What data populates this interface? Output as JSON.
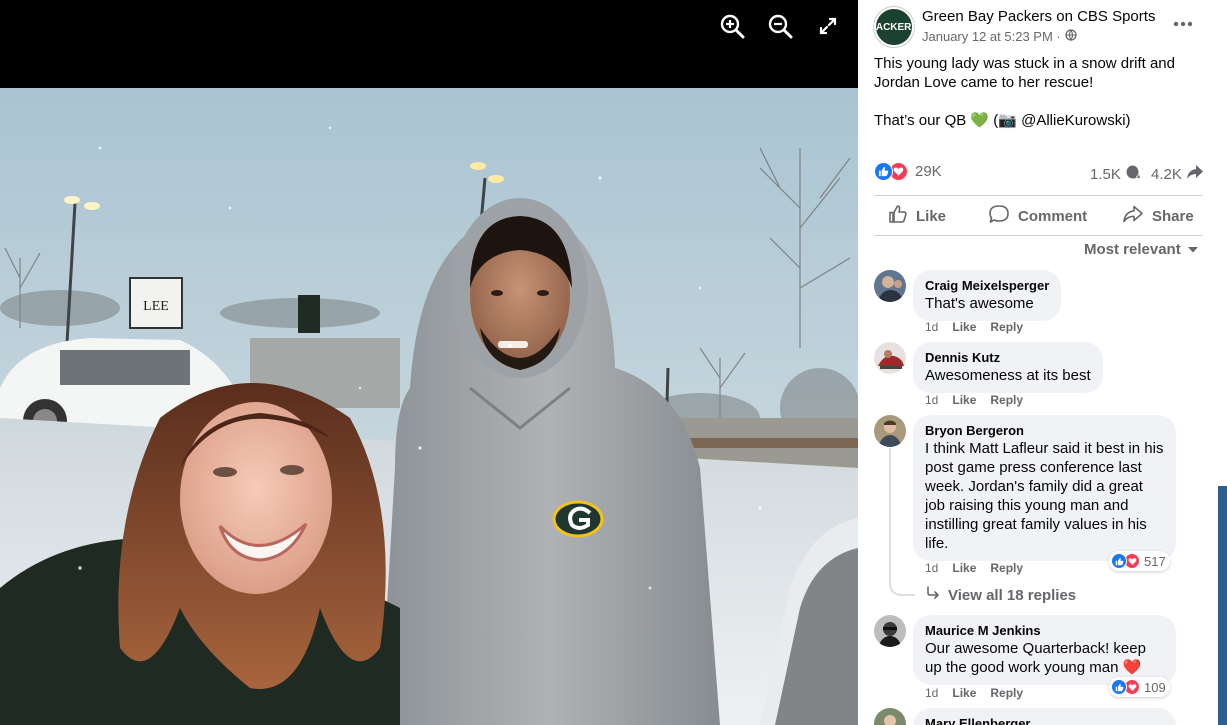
{
  "post": {
    "page_name": "Green Bay Packers on CBS Sports",
    "avatar_text": "PACKERS",
    "timestamp": "January 12 at 5:23 PM · ",
    "text_line1": "This young lady was stuck in a snow drift and Jordan Love came to her rescue!",
    "text_line2": "That’s our QB 💚 (📷 @AllieKurowski)",
    "reactions_count": "29K",
    "comments_count": "1.5K",
    "shares_count": "4.2K"
  },
  "actions": {
    "like": "Like",
    "comment": "Comment",
    "share": "Share"
  },
  "sort_label": "Most relevant",
  "comments": [
    {
      "author": "Craig Meixelsperger",
      "text": "That's awesome",
      "time": "1d",
      "like": "Like",
      "reply": "Reply"
    },
    {
      "author": "Dennis Kutz",
      "text": "Awesomeness at its best",
      "time": "1d",
      "like": "Like",
      "reply": "Reply"
    },
    {
      "author": "Bryon Bergeron",
      "text": "I think Matt Lafleur said it best in his post game press conference last week. Jordan's family did a great job raising this young man and instilling great family values in his life.",
      "time": "1d",
      "like": "Like",
      "reply": "Reply",
      "reaction_count": "517"
    },
    {
      "author": "Maurice M Jenkins",
      "text": "Our awesome Quarterback! keep up the good work young man ❤️",
      "time": "1d",
      "like": "Like",
      "reply": "Reply",
      "reaction_count": "109"
    },
    {
      "author": "Mary Ellenberger"
    }
  ],
  "view_replies": "View all 18 replies",
  "icons": {
    "zoom_in": "zoom-in-icon",
    "zoom_out": "zoom-out-icon",
    "fullscreen": "fullscreen-icon",
    "more": "more-options-icon",
    "globe": "globe-icon"
  },
  "colors": {
    "brand_blue": "#1877f2",
    "love_red": "#f33e58",
    "packers_green": "#1b4230",
    "muted_text": "#65676b"
  }
}
